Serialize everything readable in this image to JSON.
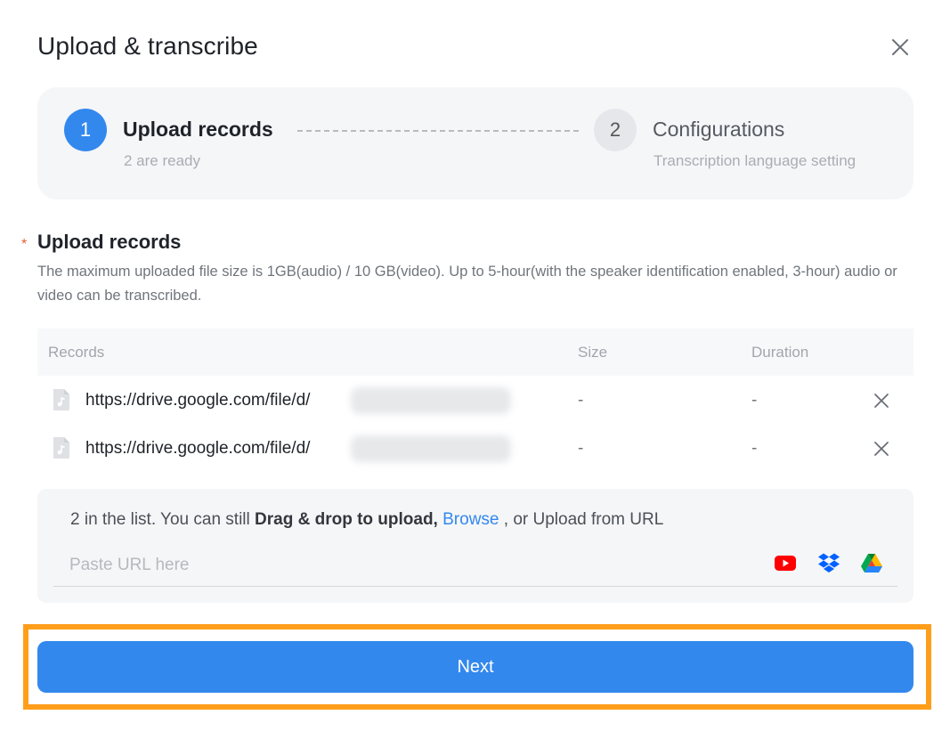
{
  "dialog": {
    "title": "Upload & transcribe"
  },
  "steps": [
    {
      "number": "1",
      "title": "Upload records",
      "subtitle": "2 are ready"
    },
    {
      "number": "2",
      "title": "Configurations",
      "subtitle": "Transcription language setting"
    }
  ],
  "upload_section": {
    "required_mark": "*",
    "label": "Upload records",
    "description": "The maximum uploaded file size is 1GB(audio) / 10 GB(video). Up to 5-hour(with the speaker identification enabled, 3-hour) audio or video can be transcribed."
  },
  "table": {
    "columns": [
      "Records",
      "Size",
      "Duration"
    ],
    "rows": [
      {
        "url": "https://drive.google.com/file/d/",
        "size": "-",
        "duration": "-"
      },
      {
        "url": "https://drive.google.com/file/d/",
        "size": "-",
        "duration": "-"
      }
    ]
  },
  "upload_box": {
    "count_text": "2 in the list. You can still ",
    "drag_text": "Drag & drop to upload,",
    "browse_text": "Browse",
    "tail_text": " , or Upload from URL",
    "url_placeholder": "Paste URL here",
    "url_value": "",
    "sources": [
      "youtube-icon",
      "dropbox-icon",
      "google-drive-icon"
    ]
  },
  "footer": {
    "next_label": "Next"
  },
  "colors": {
    "accent": "#3388ee",
    "highlight": "#ff9e1b",
    "required": "#e0603b"
  }
}
